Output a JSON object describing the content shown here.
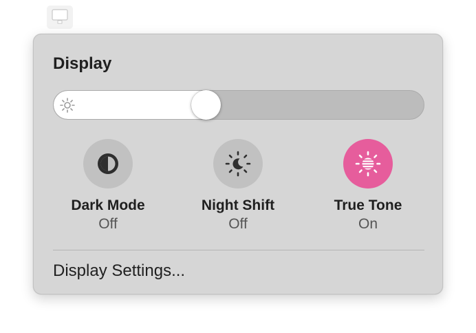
{
  "menubar": {
    "icon": "display-icon"
  },
  "panel": {
    "title": "Display",
    "brightness": {
      "level": 0.405,
      "icon": "sun-icon"
    },
    "toggles": [
      {
        "label": "Dark Mode",
        "state": "Off",
        "icon": "dark-mode-icon",
        "active": false
      },
      {
        "label": "Night Shift",
        "state": "Off",
        "icon": "night-shift-icon",
        "active": false
      },
      {
        "label": "True Tone",
        "state": "On",
        "icon": "true-tone-icon",
        "active": true,
        "color": "#e65d9c"
      }
    ],
    "settings_link": "Display Settings..."
  }
}
